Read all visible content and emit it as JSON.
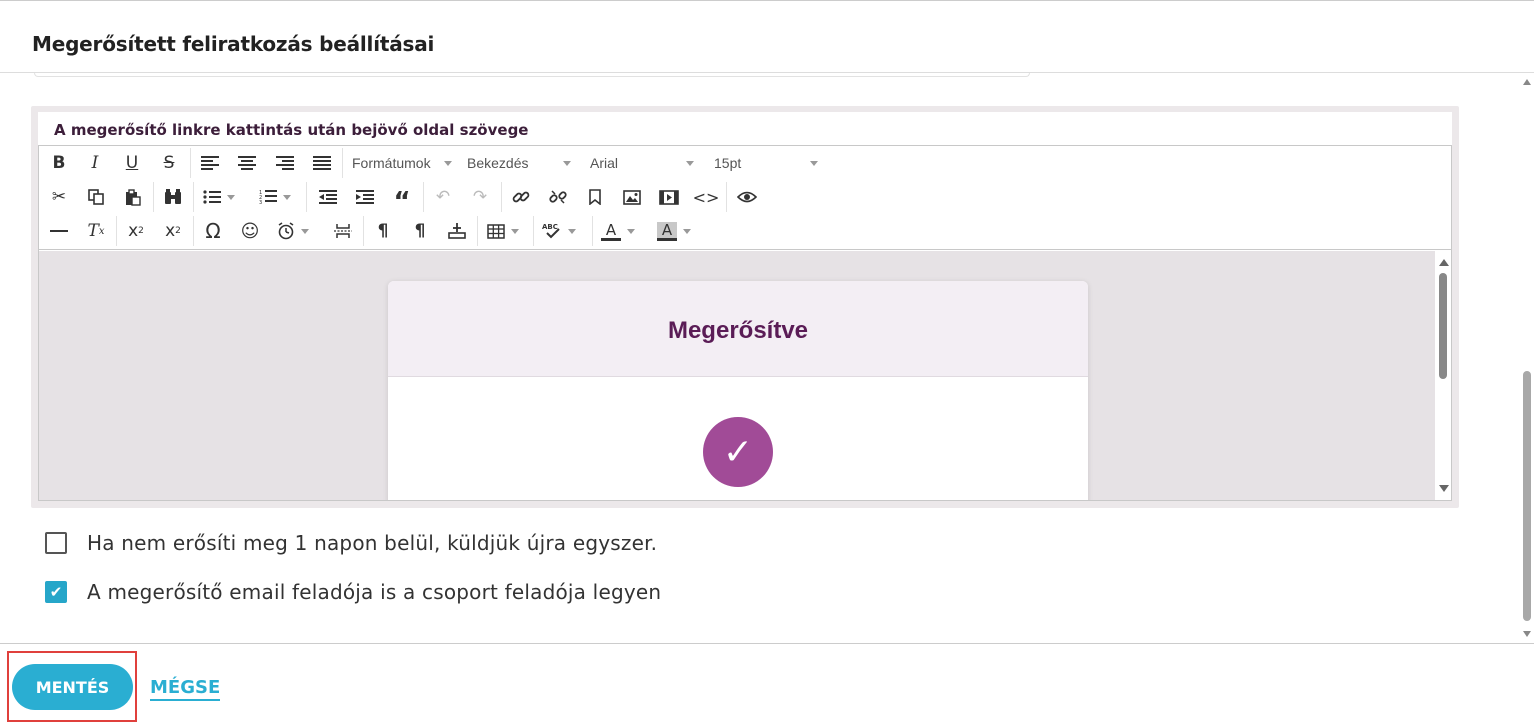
{
  "dialog": {
    "title": "Megerősített feliratkozás beállításai"
  },
  "editor": {
    "label": "A megerősítő linkre kattintás után bejövő oldal szövege",
    "toolbar": {
      "formats": "Formátumok",
      "block": "Bekezdés",
      "font": "Arial",
      "size": "15pt"
    },
    "content": {
      "heading": "Megerősítve",
      "check_glyph": "✓"
    }
  },
  "options": [
    {
      "label": "Ha nem erősíti meg 1 napon belül, küldjük újra egyszer.",
      "checked": false
    },
    {
      "label": "A megerősítő email feladója is a csoport feladója legyen",
      "checked": true
    }
  ],
  "footer": {
    "save_label": "MENTÉS",
    "cancel_label": "MÉGSE"
  },
  "colors": {
    "accent": "#2aaed2",
    "brand": "#a14b97",
    "heading": "#5a1c56",
    "highlight": "#e0403c"
  }
}
